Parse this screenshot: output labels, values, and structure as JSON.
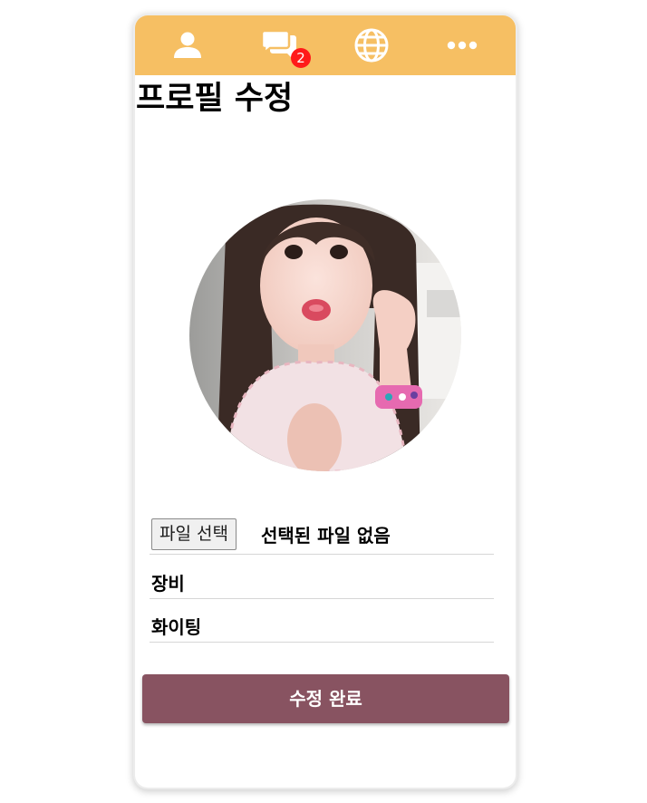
{
  "nav": {
    "items": [
      {
        "icon": "person-icon"
      },
      {
        "icon": "chat-icon",
        "badge": "2"
      },
      {
        "icon": "globe-icon"
      },
      {
        "icon": "more-icon"
      }
    ],
    "bar_color": "#f6bf63"
  },
  "page": {
    "title": "프로필 수정"
  },
  "profile": {
    "avatar": "profile-photo"
  },
  "file_input": {
    "button_label": "파일 선택",
    "status": "선택된 파일 없음"
  },
  "form": {
    "name_value": "장비",
    "intro_value": "화이팅"
  },
  "actions": {
    "submit_label": "수정 완료",
    "submit_color": "#885361"
  }
}
